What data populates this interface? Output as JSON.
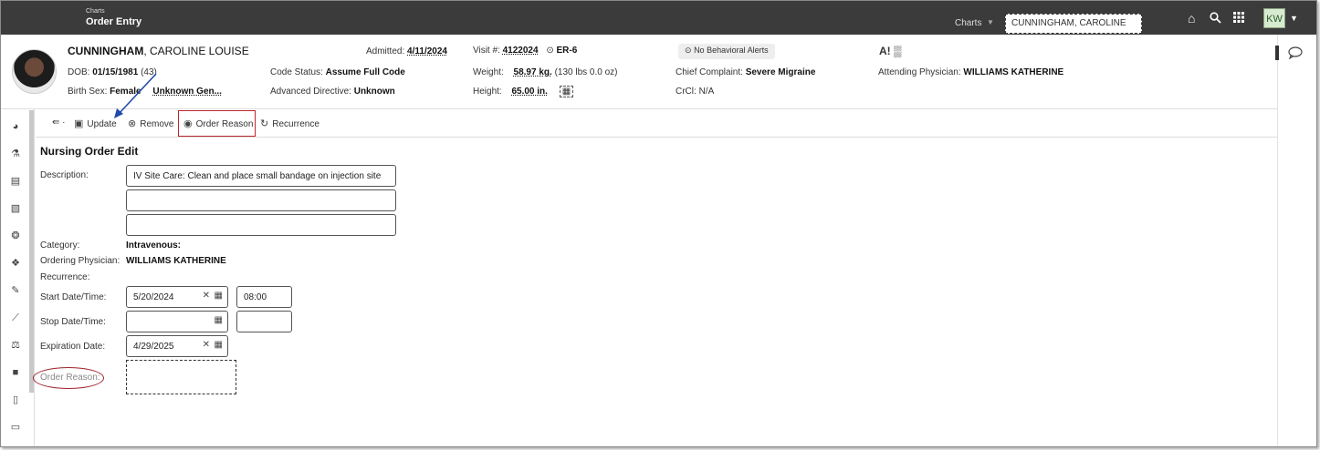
{
  "topbar": {
    "breadcrumb_small": "Charts",
    "page_title": "Order Entry",
    "charts_menu": "Charts",
    "patient_search": "CUNNINGHAM, CAROLINE",
    "user_initials": "KW",
    "icons": [
      "home-icon",
      "search-icon",
      "apps-grid-icon",
      "chevron-down-icon"
    ]
  },
  "patient": {
    "last_name": "CUNNINGHAM",
    "first_middle": ", CAROLINE LOUISE",
    "dob_label": "DOB:",
    "dob": "01/15/1981",
    "age": "(43)",
    "birth_sex_label": "Birth Sex:",
    "birth_sex": "Female",
    "gender": "Unknown Gen...",
    "admitted_label": "Admitted:",
    "admitted": "4/11/2024",
    "code_status_label": "Code Status:",
    "code_status": "Assume Full Code",
    "adv_directive_label": "Advanced Directive:",
    "adv_directive": "Unknown",
    "visit_label": "Visit #:",
    "visit": "4122024",
    "location": "ER-6",
    "weight_label": "Weight:",
    "weight": "58.97 kg.",
    "weight_lbs": "(130 lbs 0.0 oz)",
    "height_label": "Height:",
    "height": "65.00 in.",
    "behavioral_alerts": "No Behavioral Alerts",
    "chief_complaint_label": "Chief Complaint:",
    "chief_complaint": "Severe Migraine",
    "crcl_label": "CrCl:",
    "crcl": "N/A",
    "attending_label": "Attending Physician:",
    "attending": "WILLIAMS KATHERINE"
  },
  "toolbar": {
    "update": "Update",
    "remove": "Remove",
    "order_reason": "Order Reason",
    "recurrence": "Recurrence"
  },
  "form": {
    "title": "Nursing Order Edit",
    "description_label": "Description:",
    "description_1": "IV Site Care: Clean and place small bandage on injection site",
    "description_2": "",
    "description_3": "",
    "category_label": "Category:",
    "category": "Intravenous:",
    "ordering_label": "Ordering Physician:",
    "ordering": "WILLIAMS KATHERINE",
    "recurrence_label": "Recurrence:",
    "start_label": "Start Date/Time:",
    "start_date": "5/20/2024",
    "start_time": "08:00",
    "stop_label": "Stop Date/Time:",
    "stop_date": "",
    "stop_time": "",
    "expiration_label": "Expiration Date:",
    "expiration_date": "4/29/2025",
    "order_reason_label": "Order Reason:",
    "order_reason": ""
  },
  "colors": {
    "topbar_bg": "#3b3b3b",
    "highlight_red": "#c0262c",
    "annotation_arrow": "#1f4aa8"
  }
}
